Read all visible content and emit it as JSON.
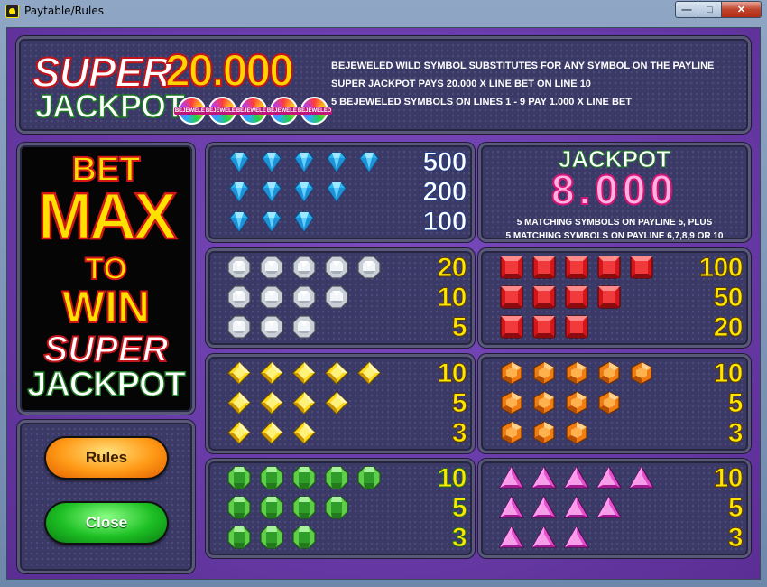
{
  "window": {
    "title": "Paytable/Rules",
    "minimize": "—",
    "maximize": "□",
    "close": "✕"
  },
  "banner": {
    "super": "SUPER",
    "jackpot": "JACKPOT",
    "amount": "20.000",
    "logo_text": "BEJEWELED",
    "logo_count": 5,
    "rules": [
      "BEJEWELED WILD SYMBOL SUBSTITUTES FOR ANY SYMBOL ON THE PAYLINE",
      "SUPER JACKPOT PAYS 20.000 X LINE BET ON LINE 10",
      "5 BEJEWELED SYMBOLS ON LINES 1 - 9 PAY 1.000 X LINE BET"
    ]
  },
  "betmax": {
    "bet": "BET",
    "max": "MAX",
    "to": "TO",
    "win": "WIN",
    "super": "SUPER",
    "jackpot": "JACKPOT"
  },
  "buttons": {
    "rules": "Rules",
    "close": "Close"
  },
  "jackpot": {
    "title": "JACKPOT",
    "amount": "8.000",
    "note1": "5 MATCHING SYMBOLS ON PAYLINE 5, PLUS",
    "note2": "5 MATCHING SYMBOLS ON PAYLINE 6,7,8,9 OR 10"
  },
  "paytable": [
    {
      "gem": "blue-diamond",
      "pays": [
        "500",
        "200",
        "100"
      ],
      "style": "white"
    },
    {
      "gem": "white-round",
      "pays": [
        "20",
        "10",
        "5"
      ],
      "style": "yellow"
    },
    {
      "gem": "red-square",
      "pays": [
        "100",
        "50",
        "20"
      ],
      "style": "yellow"
    },
    {
      "gem": "yellow-diamond",
      "pays": [
        "10",
        "5",
        "3"
      ],
      "style": "yellow"
    },
    {
      "gem": "orange-hexagon",
      "pays": [
        "10",
        "5",
        "3"
      ],
      "style": "yellow"
    },
    {
      "gem": "green-octagon",
      "pays": [
        "10",
        "5",
        "3"
      ],
      "style": "green"
    },
    {
      "gem": "purple-triangle",
      "pays": [
        "10",
        "5",
        "3"
      ],
      "style": "yellow"
    }
  ],
  "colors": {
    "background": "#6a3fa6",
    "panel": "#3b3a66",
    "accent_yellow": "#ffe100",
    "accent_red": "#d11616"
  }
}
